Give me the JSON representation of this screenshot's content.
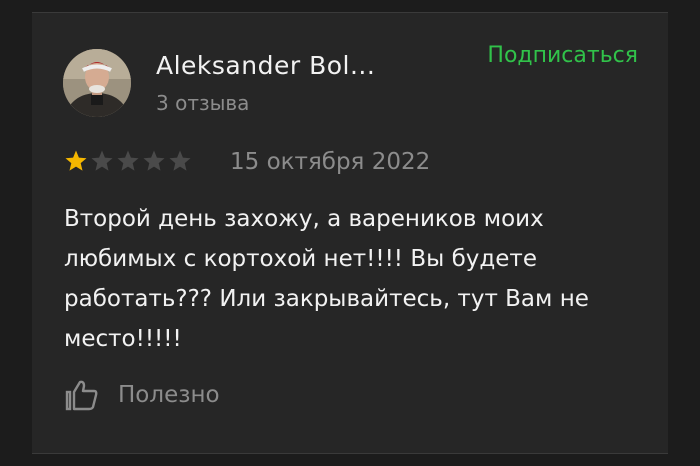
{
  "review": {
    "author_name": "Aleksander Bol...",
    "review_count": "3 отзыва",
    "subscribe_label": "Подписаться",
    "rating": 1,
    "rating_max": 5,
    "date": "15 октября 2022",
    "text": "Второй день захожу, а вареников моих любимых с кортохой нет!!!! Вы будете работать??? Или закрывайтесь, тут Вам не место!!!!!",
    "helpful_label": "Полезно",
    "icons": {
      "avatar": "avatar-photo",
      "star": "star-icon",
      "helpful": "thumbs-up-icon"
    }
  },
  "colors": {
    "background": "#1c1c1c",
    "card": "#262626",
    "text": "#f2f2f2",
    "muted": "#8c8c8c",
    "accent": "#31c24a",
    "star_filled": "#f5b700",
    "star_empty": "#4a4a4a"
  }
}
